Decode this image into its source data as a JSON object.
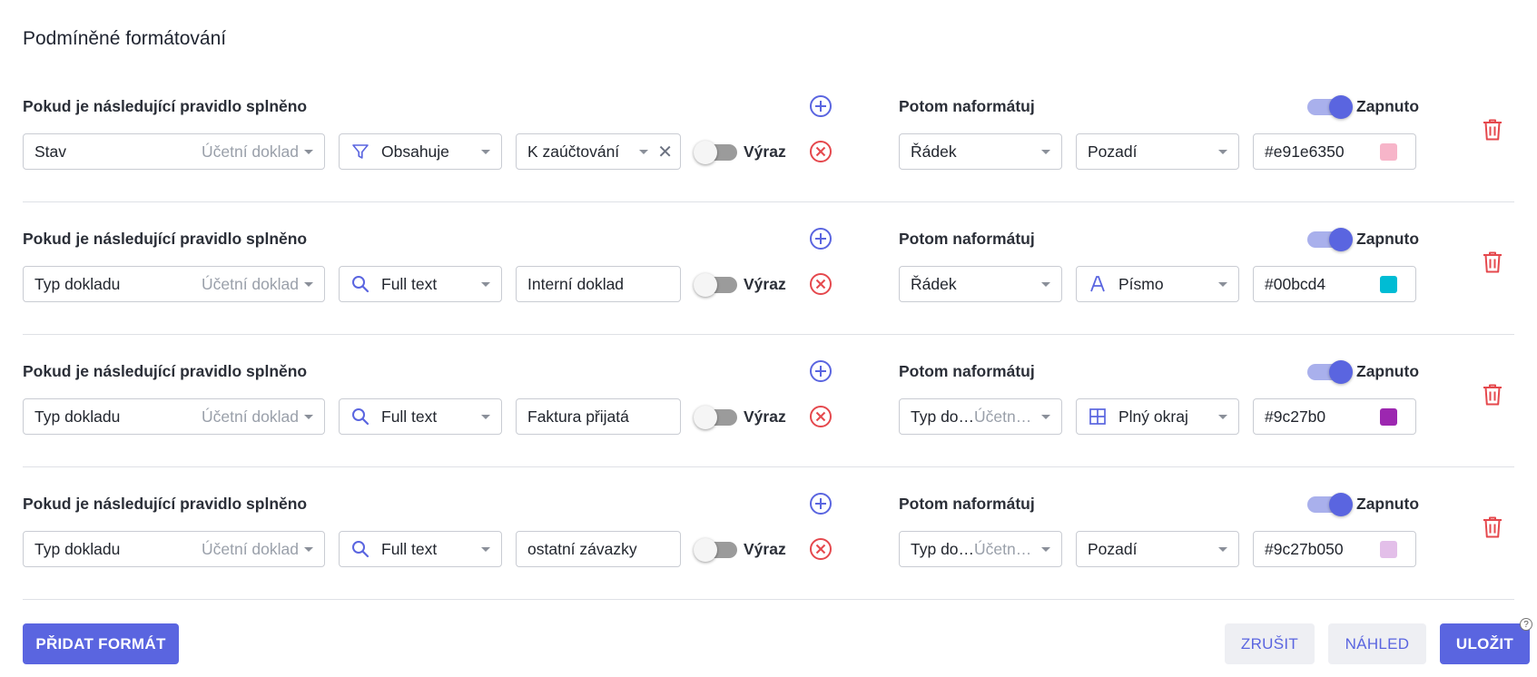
{
  "dialog": {
    "title": "Podmíněné formátování"
  },
  "labels": {
    "condition_header": "Pokud je následující pravidlo splněno",
    "format_header": "Potom naformátuj",
    "expression": "Výraz",
    "enabled": "Zapnuto"
  },
  "rules": [
    {
      "field": "Stav",
      "field_hint": "Účetní doklad",
      "operator": "Obsahuje",
      "operator_icon": "filter-icon",
      "value": "K zaúčtování",
      "value_is_select": true,
      "expression_on": false,
      "target": "Řádek",
      "target_hint": "",
      "format_type": "Pozadí",
      "format_icon": "",
      "color": "#e91e6350",
      "color_display": "#f7b5c9",
      "enabled": true
    },
    {
      "field": "Typ dokladu",
      "field_hint": "Účetní doklad",
      "operator": "Full text",
      "operator_icon": "search-icon",
      "value": "Interní doklad",
      "value_is_select": false,
      "expression_on": false,
      "target": "Řádek",
      "target_hint": "",
      "format_type": "Písmo",
      "format_icon": "font-icon",
      "color": "#00bcd4",
      "color_display": "#00bcd4",
      "enabled": true
    },
    {
      "field": "Typ dokladu",
      "field_hint": "Účetní doklad",
      "operator": "Full text",
      "operator_icon": "search-icon",
      "value": "Faktura přijatá",
      "value_is_select": false,
      "expression_on": false,
      "target": "Typ do…",
      "target_hint": "Účetní …",
      "format_type": "Plný okraj",
      "format_icon": "border-all-icon",
      "color": "#9c27b0",
      "color_display": "#9c27b0",
      "enabled": true
    },
    {
      "field": "Typ dokladu",
      "field_hint": "Účetní doklad",
      "operator": "Full text",
      "operator_icon": "search-icon",
      "value": "ostatní závazky",
      "value_is_select": false,
      "expression_on": false,
      "target": "Typ do…",
      "target_hint": "Účetní …",
      "format_type": "Pozadí",
      "format_icon": "",
      "color": "#9c27b050",
      "color_display": "#e3bfe9",
      "enabled": true
    }
  ],
  "footer": {
    "add_format": "PŘIDAT FORMÁT",
    "cancel": "ZRUŠIT",
    "preview": "NÁHLED",
    "save": "ULOŽIT",
    "help": "?"
  },
  "colors": {
    "accent": "#5a65e0",
    "danger": "#e5484d"
  }
}
